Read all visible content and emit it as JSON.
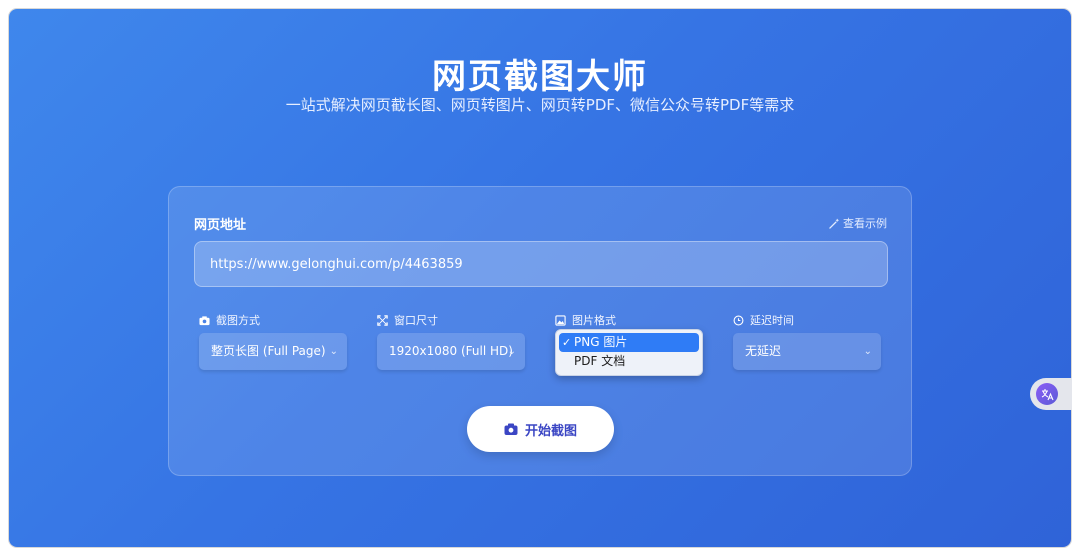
{
  "header": {
    "title": "网页截图大师",
    "subtitle": "一站式解决网页截长图、网页转图片、网页转PDF、微信公众号转PDF等需求"
  },
  "form": {
    "url_label": "网页地址",
    "example_link": "查看示例",
    "url_value": "https://www.gelonghui.com/p/4463859",
    "options": {
      "mode": {
        "label": "截图方式",
        "value": "整页长图 (Full Page)"
      },
      "window": {
        "label": "窗口尺寸",
        "value": "1920x1080 (Full HD)"
      },
      "format": {
        "label": "图片格式",
        "items": [
          "PNG 图片",
          "PDF 文档"
        ],
        "selected": "PNG 图片"
      },
      "delay": {
        "label": "延迟时间",
        "value": "无延迟"
      }
    },
    "start_button": "开始截图"
  },
  "colors": {
    "gradient_start": "#3f87ec",
    "gradient_end": "#2f63d8",
    "button_text": "#3b46c4",
    "dropdown_highlight": "#2f7cf6"
  },
  "icons": {
    "example": "magic-wand-icon",
    "mode": "camera-icon",
    "window": "expand-icon",
    "format": "image-icon",
    "delay": "clock-icon",
    "start": "camera-icon",
    "fab": "translate-icon"
  }
}
